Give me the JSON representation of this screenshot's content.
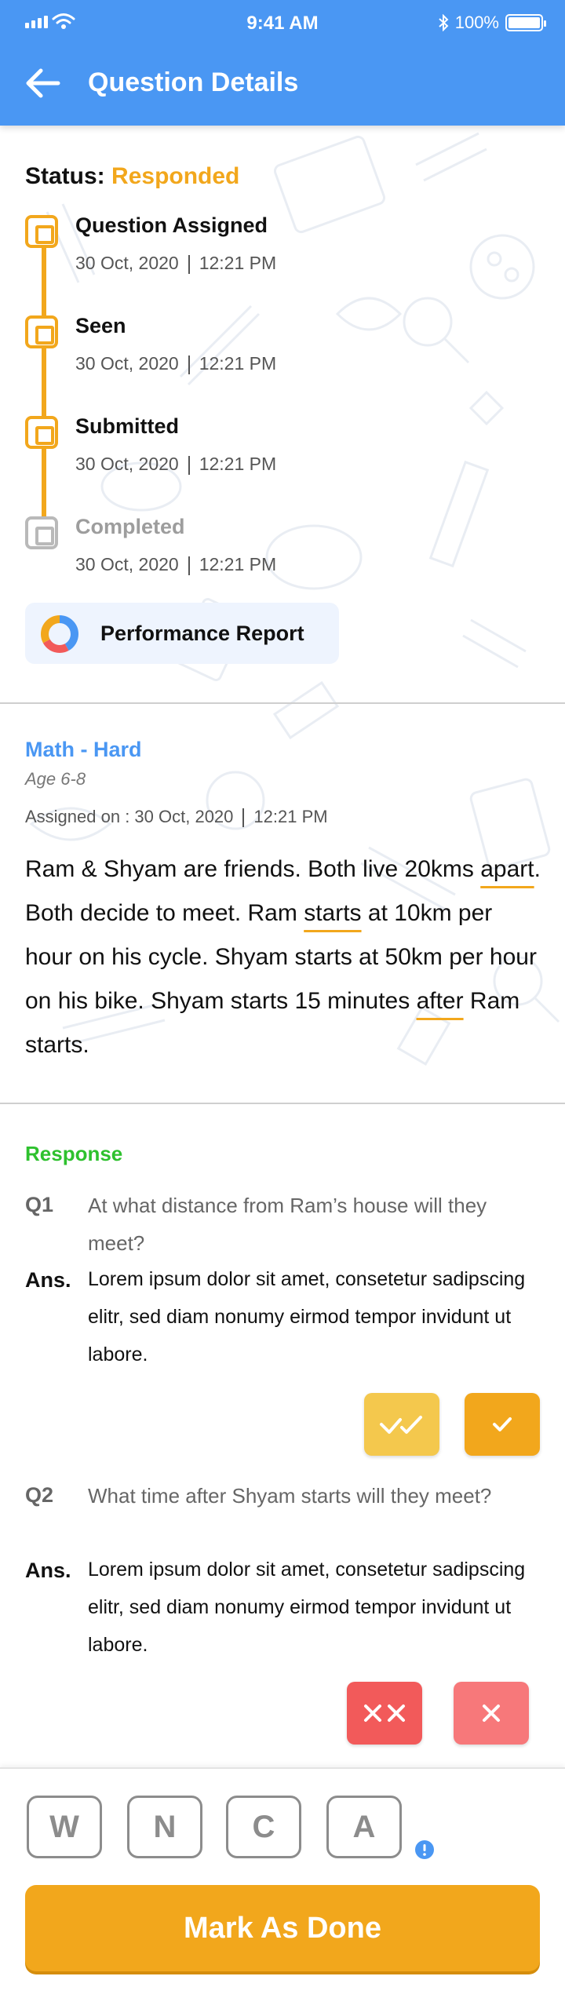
{
  "status_bar": {
    "time": "9:41 AM",
    "battery": "100%"
  },
  "header": {
    "title": "Question Details",
    "back_icon": "arrow-left-icon"
  },
  "status": {
    "label": "Status:",
    "value": "Responded",
    "value_color": "#f2a71c",
    "steps": [
      {
        "title": "Question Assigned",
        "date": "30 Oct, 2020",
        "time": "12:21 PM",
        "state": "done"
      },
      {
        "title": "Seen",
        "date": "30 Oct, 2020",
        "time": "12:21 PM",
        "state": "done"
      },
      {
        "title": "Submitted",
        "date": "30 Oct, 2020",
        "time": "12:21 PM",
        "state": "done"
      },
      {
        "title": "Completed",
        "date": "30 Oct, 2020",
        "time": "12:21 PM",
        "state": "pending"
      }
    ]
  },
  "performance_report": {
    "label": "Performance Report",
    "icon": "donut-chart-icon"
  },
  "question": {
    "subject": "Math - Hard",
    "age": "Age 6-8",
    "assigned_label": "Assigned on : 30 Oct, 2020",
    "assigned_time": "12:21 PM",
    "text_parts": [
      "Ram & Shyam are friends. Both live 20kms ",
      "apart",
      ". Both decide to meet. Ram ",
      "starts",
      " at 10km per hour on his cycle. Shyam starts at 50km per hour on his bike. Shyam starts 15 minutes ",
      "after",
      " Ram starts."
    ]
  },
  "response": {
    "label": "Response",
    "items": [
      {
        "qnum": "Q1",
        "question": "At what distance from Ram’s house will they meet?",
        "ans_label": "Ans.",
        "answer": "Lorem ipsum dolor sit amet, consetetur sadipscing elitr, sed diam nonumy eirmod tempor invidunt ut labore.",
        "marks": [
          "double-check-icon",
          "check-icon"
        ]
      },
      {
        "qnum": "Q2",
        "question": "What time after Shyam starts will they meet?",
        "ans_label": "Ans.",
        "answer": "Lorem ipsum dolor sit amet, consetetur sadipscing elitr, sed diam nonumy eirmod tempor invidunt ut labore.",
        "marks": [
          "double-cross-icon",
          "cross-icon"
        ]
      }
    ]
  },
  "grades": [
    "W",
    "N",
    "C",
    "A"
  ],
  "mark_done_label": "Mark As Done",
  "colors": {
    "primary": "#4a97f3",
    "accent": "#f2a71c",
    "accent_light": "#f4c84d",
    "response_green": "#2ec12e",
    "error_red": "#f25a5a",
    "error_light": "#f7787a"
  }
}
